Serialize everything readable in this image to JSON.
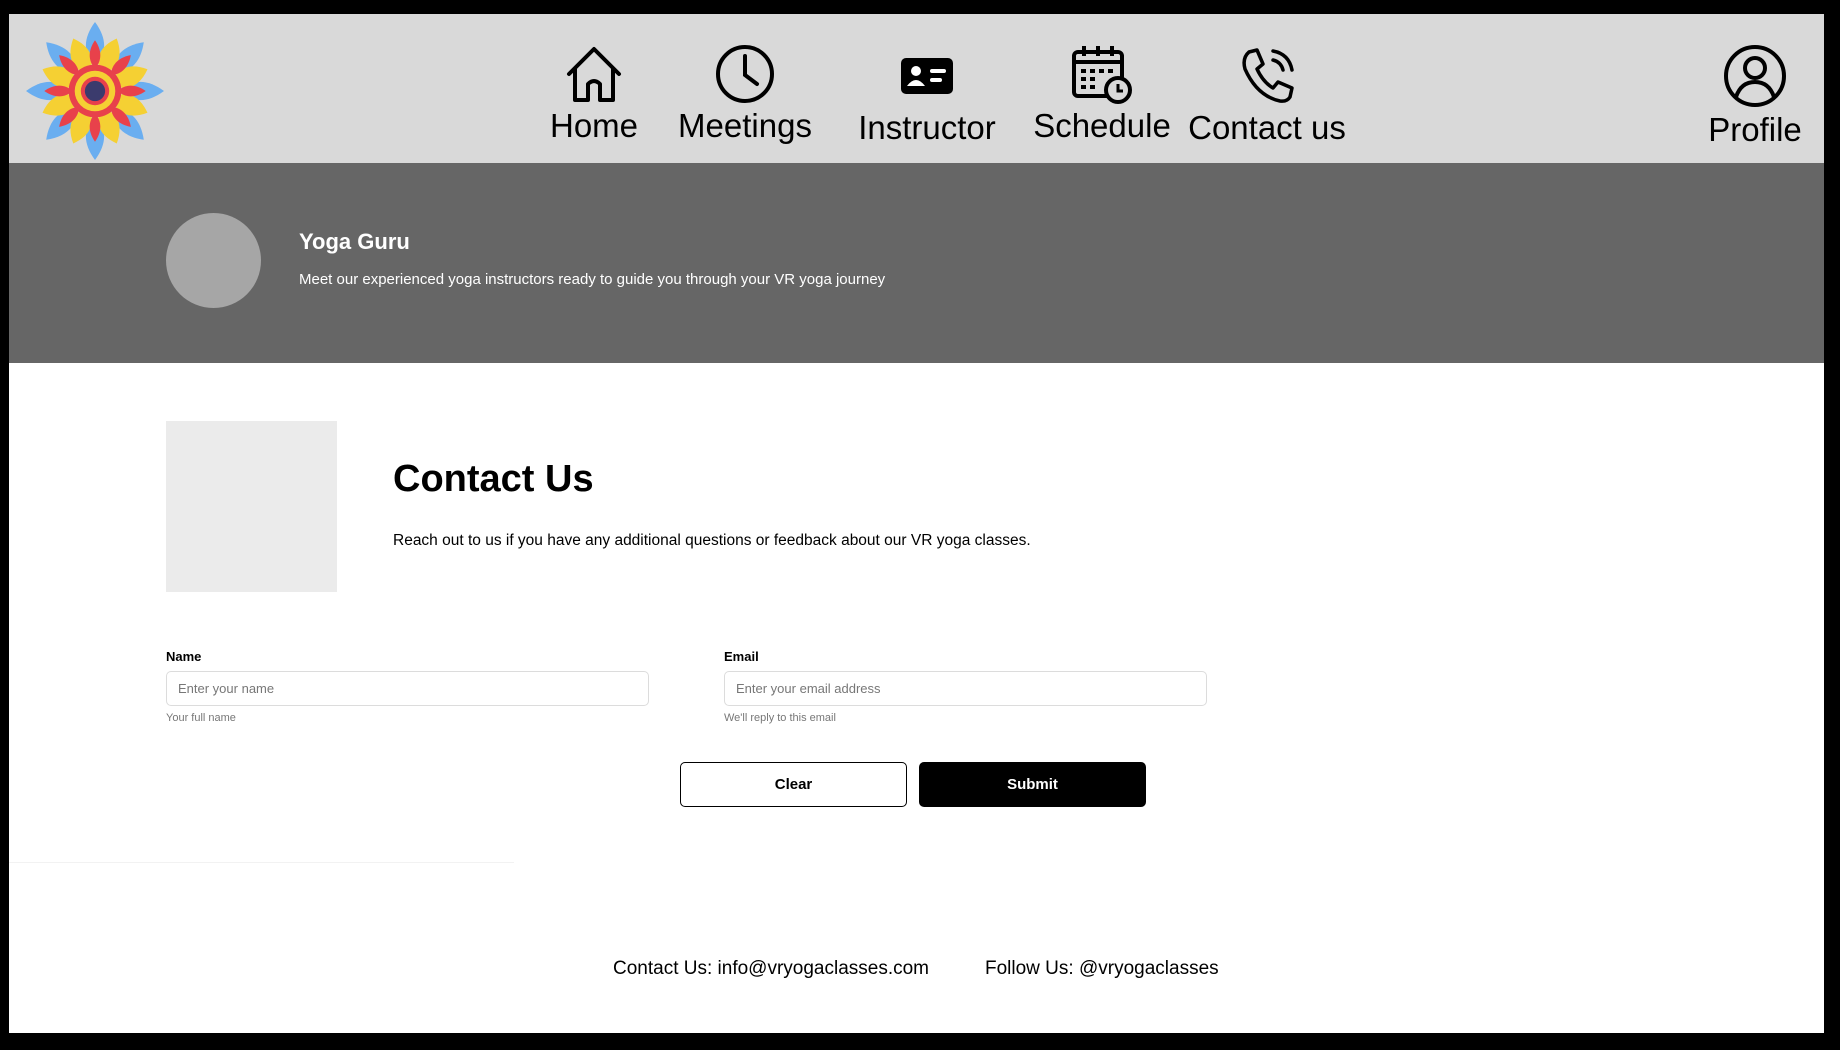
{
  "nav": {
    "items": [
      {
        "label": "Home",
        "icon": "home-icon"
      },
      {
        "label": "Meetings",
        "icon": "clock-icon"
      },
      {
        "label": "Instructor",
        "icon": "id-card-icon"
      },
      {
        "label": "Schedule",
        "icon": "calendar-clock-icon"
      },
      {
        "label": "Contact us",
        "icon": "phone-icon"
      }
    ],
    "profile": {
      "label": "Profile",
      "icon": "user-circle-icon"
    },
    "logo_icon": "mandala-flower-logo"
  },
  "hero": {
    "title": "Yoga Guru",
    "subtitle": "Meet our experienced yoga instructors ready to guide you through your VR yoga journey"
  },
  "contact": {
    "title": "Contact Us",
    "description": "Reach out to us if you have any additional questions or feedback about our VR yoga classes.",
    "name_field": {
      "label": "Name",
      "placeholder": "Enter your name",
      "help": "Your full name",
      "value": ""
    },
    "email_field": {
      "label": "Email",
      "placeholder": "Enter your email address",
      "help": "We'll reply to this email",
      "value": ""
    },
    "clear_label": "Clear",
    "submit_label": "Submit"
  },
  "footer": {
    "contact": "Contact Us: info@vryogaclasses.com",
    "follow": "Follow Us: @vryogaclasses"
  },
  "colors": {
    "topbar_bg": "#d9d9d9",
    "hero_bg": "#666666",
    "accent": "#000000"
  }
}
